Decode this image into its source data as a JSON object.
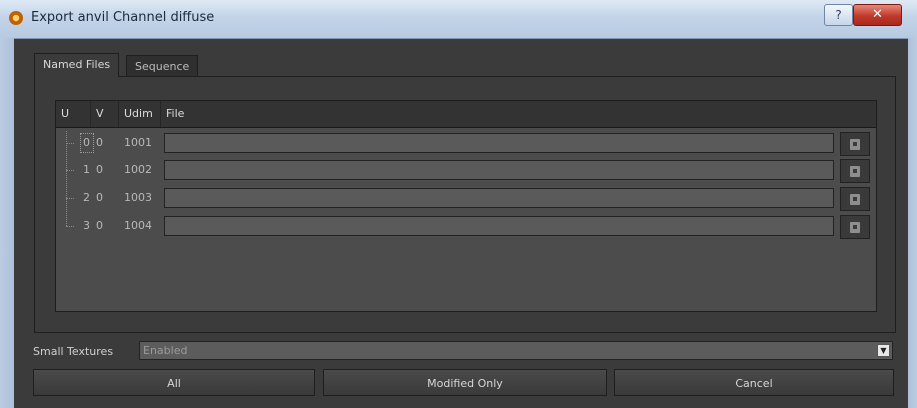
{
  "window": {
    "title": "Export anvil Channel diffuse",
    "help_label": "?",
    "close_label": "✕"
  },
  "tabs": [
    {
      "label": "Named Files",
      "active": true
    },
    {
      "label": "Sequence",
      "active": false
    }
  ],
  "table": {
    "columns": [
      "U",
      "V",
      "Udim",
      "File"
    ],
    "rows": [
      {
        "u": "0",
        "v": "0",
        "udim": "1001",
        "file": ""
      },
      {
        "u": "1",
        "v": "0",
        "udim": "1002",
        "file": ""
      },
      {
        "u": "2",
        "v": "0",
        "udim": "1003",
        "file": ""
      },
      {
        "u": "3",
        "v": "0",
        "udim": "1004",
        "file": ""
      }
    ]
  },
  "small_textures": {
    "label": "Small Textures",
    "value": "Enabled"
  },
  "buttons": {
    "all": "All",
    "modified_only": "Modified Only",
    "cancel": "Cancel"
  },
  "icons": {
    "app": "app-icon",
    "browse": "browse-file-icon",
    "dropdown": "chevron-down-icon"
  }
}
